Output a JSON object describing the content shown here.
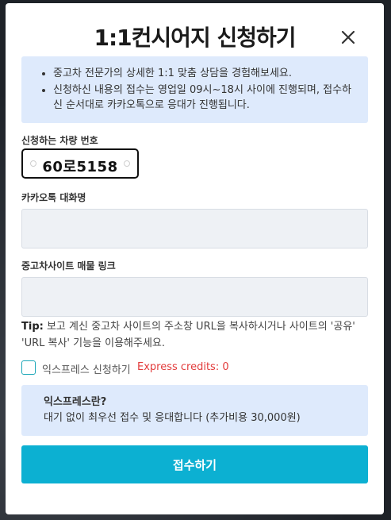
{
  "modal": {
    "title": "1:1컨시어지 신청하기",
    "info_items": [
      "중고차 전문가의 상세한 1:1 맞춤 상담을 경험해보세요.",
      "신청하신 내용의 접수는 영업일 09시~18시 사이에 진행되며, 접수하신 순서대로 카카오톡으로 응대가 진행됩니다."
    ],
    "vehicle_number_label": "신청하는 차량 번호",
    "vehicle_number": "60로5158",
    "kakao_name_label": "카카오톡 대화명",
    "kakao_name_value": "",
    "listing_link_label": "중고차사이트 매물 링크",
    "listing_link_value": "",
    "tip_prefix": "Tip:",
    "tip_text": " 보고 계신 중고차 사이트의 주소창 URL을 복사하시거나 사이트의 '공유' 'URL 복사' 기능을 이용해주세요.",
    "express_checkbox_label": "익스프레스 신청하기",
    "express_checked": false,
    "express_credits": "Express credits: 0",
    "express_info_title": "익스프레스란?",
    "express_info_text": "대기 없이 최우선 접수 및 응대합니다 (추가비용 30,000원)",
    "submit_label": "접수하기"
  },
  "colors": {
    "accent": "#0cb0d2",
    "info_bg": "#deeafc",
    "credits": "#e23b3b",
    "field_bg": "#eef1f5"
  },
  "icons": {
    "close": "close-icon"
  }
}
